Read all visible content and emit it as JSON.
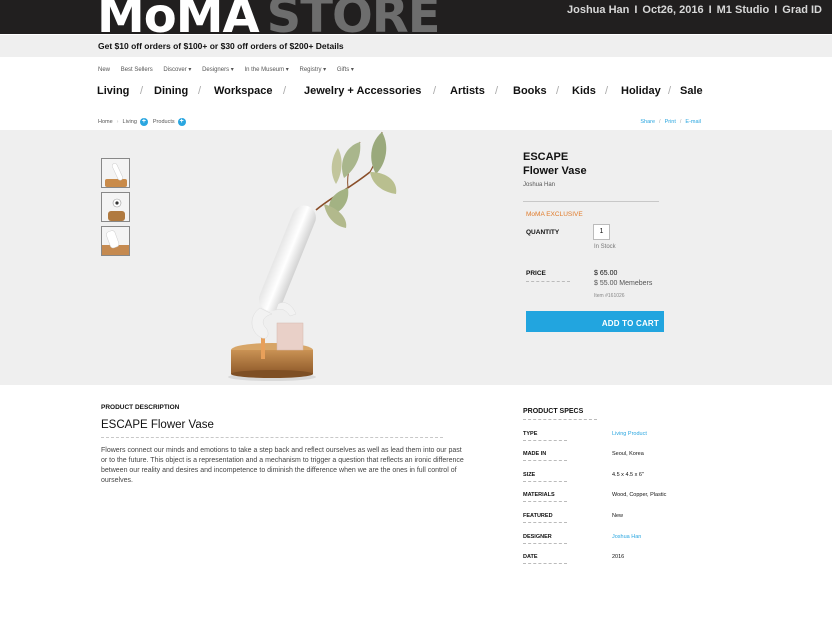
{
  "header": {
    "logo_moma": "MoMA",
    "logo_store": "STORE",
    "meta": [
      "Joshua Han",
      "Oct26, 2016",
      "M1 Studio",
      "Grad ID"
    ],
    "meta_separator": "I"
  },
  "promo": {
    "text": "Get $10 off orders of $100+ or $30 off orders of $200+ Details"
  },
  "utility_nav": [
    "New",
    "Best Sellers",
    "Discover ▾",
    "Designers ▾",
    "In the Museum ▾",
    "Registry ▾",
    "Gifts ▾"
  ],
  "main_nav": [
    "Living",
    "Dining",
    "Workspace",
    "Jewelry + Accessories",
    "Artists",
    "Books",
    "Kids",
    "Holiday",
    "Sale"
  ],
  "breadcrumb": [
    "Home",
    "Living",
    "Products"
  ],
  "share_links": [
    "Share",
    "Print",
    "E-mail"
  ],
  "product": {
    "title_line1": "ESCAPE",
    "title_line2": "Flower Vase",
    "author": "Joshua Han",
    "badge": "MoMA EXCLUSIVE",
    "quantity_label": "QUANTITY",
    "quantity_value": "1",
    "stock": "In Stock",
    "price_label": "PRICE",
    "price": "$ 65.00",
    "price_members": "$ 55.00 Memebers",
    "item_number": "Item #161026",
    "cart_button": "ADD TO CART"
  },
  "description": {
    "heading": "PRODUCT DESCRIPTION",
    "title": "ESCAPE Flower Vase",
    "body": "Flowers connect our minds and emotions to take a step back and reflect ourselves as well as lead them into our past or to the future. This object is a representation and a mechanism to trigger a question that reflects an ironic difference between our reality and desires and incompetence to diminish the difference when we are the ones in full control of ourselves."
  },
  "specs": {
    "heading": "PRODUCT SPECS",
    "rows": [
      {
        "key": "TYPE",
        "value": "Living Product"
      },
      {
        "key": "MADE IN",
        "value": "Seoul, Korea"
      },
      {
        "key": "SIZE",
        "value": "4.5 x 4.5 x 6\""
      },
      {
        "key": "MATERIALS",
        "value": "Wood, Copper, Plastic"
      },
      {
        "key": "FEATURED",
        "value": "New"
      },
      {
        "key": "DESIGNER",
        "value": "Joshua Han"
      },
      {
        "key": "DATE",
        "value": "2016"
      }
    ]
  },
  "colors": {
    "accent": "#22a5df",
    "exclusive": "#e07b2a",
    "topbar": "#211f1f"
  }
}
